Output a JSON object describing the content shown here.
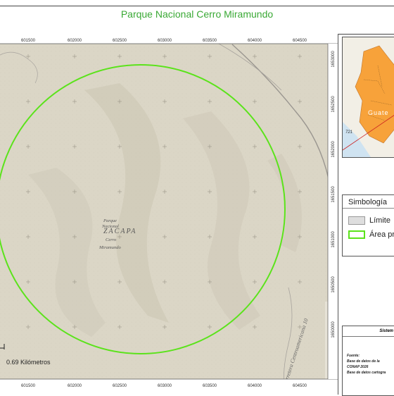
{
  "map": {
    "title": "Parque Nacional Cerro Miramundo",
    "x_ticks": [
      "601500",
      "602000",
      "602500",
      "603000",
      "603500",
      "604000",
      "604500"
    ],
    "y_ticks": [
      "1653000",
      "1652500",
      "1652000",
      "1651500",
      "1651000",
      "1650500",
      "1650000"
    ],
    "place_labels": {
      "department": "ZACAPA",
      "park_line1": "Parque",
      "park_line2": "Nacional",
      "park_line3": "Cerro",
      "park_line4": "Miramundo"
    },
    "road_label": "Carretera Centroamericana 10",
    "scale_label": "0.69 Kilómetros",
    "protected_area_color": "#5be31b",
    "terrain_color": "#dbd6c6"
  },
  "inset": {
    "label": "Guatemala",
    "label_visible": "Guate",
    "road_number": "721",
    "sea_color": "#cfe3f1",
    "highlight_color": "#f7a23a"
  },
  "legend": {
    "title": "Simbología",
    "items": [
      {
        "label": "Límite",
        "fill": "#dedede",
        "stroke": "#999999"
      },
      {
        "label": "Área pr",
        "fill": "#ffffff",
        "stroke": "#5be31b"
      }
    ]
  },
  "info": {
    "header": "Sistem",
    "source_label": "Fuente:",
    "line1": "Base de datos de la",
    "line2": "CONAP 2026",
    "line3": "Base de datos cartogra"
  }
}
